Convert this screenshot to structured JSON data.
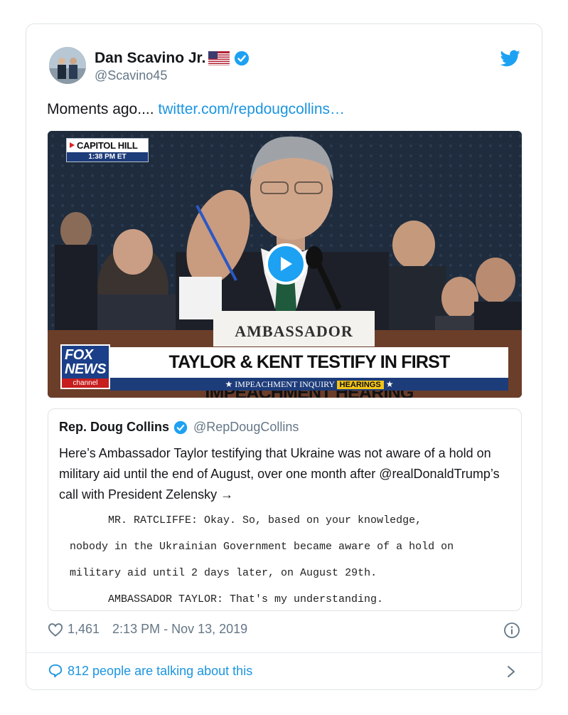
{
  "tweet": {
    "author_name": "Dan Scavino Jr.",
    "author_handle": "@Scavino45",
    "text_prefix": "Moments ago.... ",
    "link_text": "twitter.com/repdougcollins…",
    "likes": "1,461",
    "timestamp": "2:13 PM - Nov 13, 2019",
    "talking": "812 people are talking about this"
  },
  "video": {
    "location_label": "CAPITOL HILL",
    "location_time": "1:38 PM ET",
    "nameplate": "AMBASSADOR",
    "network_line1": "FOX",
    "network_line2": "NEWS",
    "network_line3": "channel",
    "headline": "TAYLOR & KENT TESTIFY IN FIRST IMPEACHMENT HEARING",
    "subhead": "★ IMPEACHMENT INQUIRY",
    "subhead_tag": "HEARINGS",
    "subhead_tail": "★"
  },
  "quoted": {
    "author_name": "Rep. Doug Collins",
    "author_handle": "@RepDougCollins",
    "text": "Here’s Ambassador Taylor testifying that Ukraine was not aware of a hold on military aid until the end of August, over one month after @realDonaldTrump’s call with President Zelensky →",
    "transcript": [
      "MR. RATCLIFFE:  Okay.  So, based on your knowledge,",
      "nobody in the Ukrainian Government became aware of a hold on",
      "military aid until 2 days later, on August 29th.",
      "AMBASSADOR TAYLOR:  That's my understanding."
    ]
  },
  "colors": {
    "link": "#1b95e0",
    "verified": "#1da1f2",
    "secondary_text": "#657786",
    "border": "#dfe3e6"
  },
  "icons": [
    "verified-badge-icon",
    "us-flag-icon",
    "twitter-bird-icon",
    "play-icon",
    "heart-icon",
    "info-icon",
    "comment-bubble-icon",
    "chevron-right-icon"
  ]
}
